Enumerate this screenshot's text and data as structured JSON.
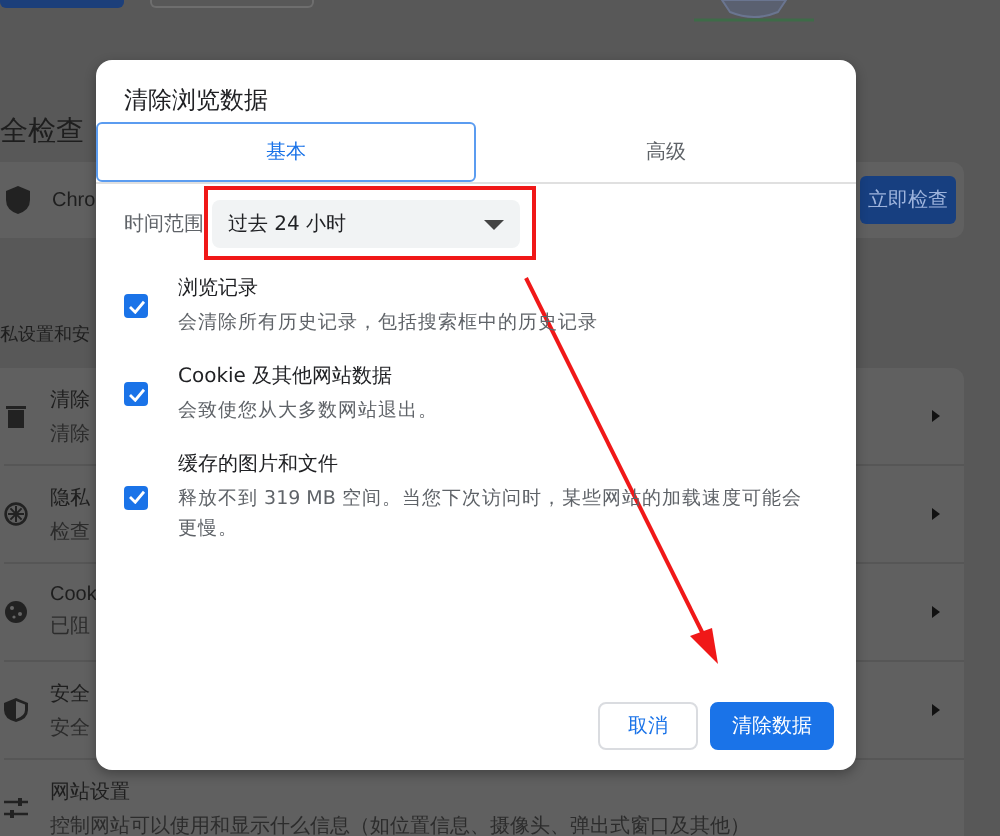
{
  "background_page": {
    "section_1_title": "全检查",
    "check_card": {
      "text": "Chro",
      "button": "立即检查"
    },
    "section_2_title": "私设置和安",
    "rows": [
      {
        "title": "清除",
        "subtitle": "清除"
      },
      {
        "title": "隐私",
        "subtitle": "检查"
      },
      {
        "title": "Cook",
        "subtitle": "已阻"
      },
      {
        "title": "安全",
        "subtitle": "安全"
      },
      {
        "title": "网站设置",
        "subtitle": "控制网站可以使用和显示什么信息（如位置信息、摄像头、弹出式窗口及其他）"
      }
    ]
  },
  "dialog": {
    "title": "清除浏览数据",
    "tabs": [
      {
        "label": "基本",
        "selected": true
      },
      {
        "label": "高级",
        "selected": false
      }
    ],
    "time_range": {
      "label": "时间范围",
      "value": "过去 24 小时"
    },
    "items": [
      {
        "title": "浏览记录",
        "description": "会清除所有历史记录，包括搜索框中的历史记录",
        "checked": true
      },
      {
        "title": "Cookie 及其他网站数据",
        "description": "会致使您从大多数网站退出。",
        "checked": true
      },
      {
        "title": "缓存的图片和文件",
        "description": "释放不到 319 MB 空间。当您下次访问时，某些网站的加载速度可能会更慢。",
        "checked": true
      }
    ],
    "buttons": [
      {
        "label": "取消",
        "kind": "secondary"
      },
      {
        "label": "清除数据",
        "kind": "primary"
      }
    ]
  }
}
